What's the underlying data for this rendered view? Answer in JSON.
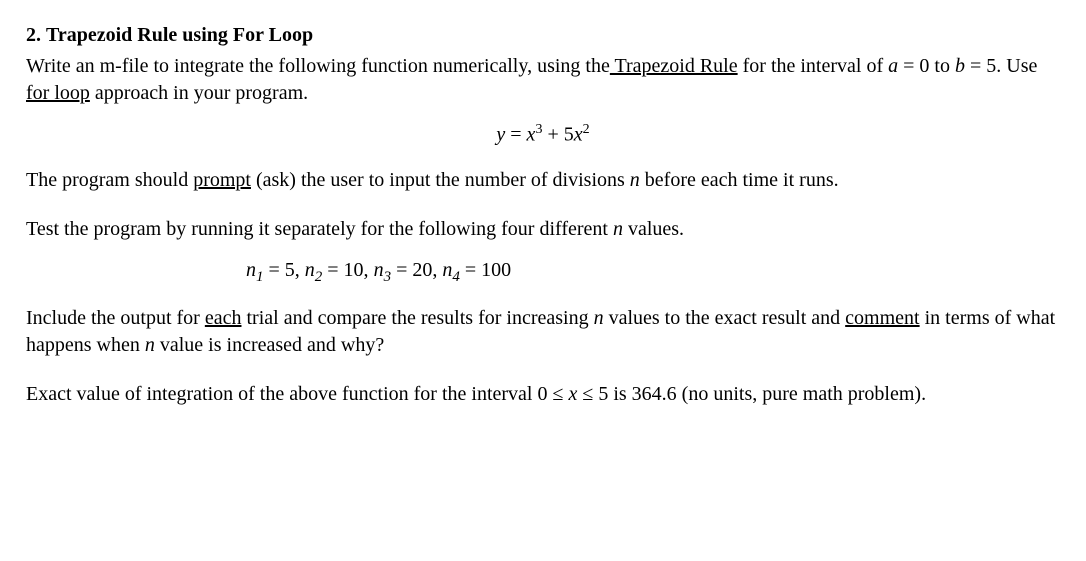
{
  "problem": {
    "number": "2.",
    "title": "Trapezoid Rule using For Loop",
    "intro_pre": "Write an m-file to integrate the following function numerically, using the",
    "intro_link1": " Trapezoid Rule",
    "intro_mid": " for the interval of ",
    "interval_a": "a",
    "interval_a_eq": " = 0",
    "interval_to": " to ",
    "interval_b": "b",
    "interval_b_eq": " = 5",
    "intro_use": ". Use ",
    "intro_link2": "for loop",
    "intro_end": " approach in your program.",
    "equation": {
      "lhs": "y",
      "eq": " = ",
      "rhs1": "x",
      "rhs1_exp": "3",
      "plus": " + 5",
      "rhs2": "x",
      "rhs2_exp": "2"
    },
    "prompt_pre": "The program should ",
    "prompt_link": "prompt",
    "prompt_post": " (ask) the user to input the number of divisions ",
    "prompt_n": "n",
    "prompt_end": " before each time it runs.",
    "test_pre": "Test the program by running it separately for the following four different ",
    "test_n": "n",
    "test_end": " values.",
    "nvals": {
      "n1_lbl": "n",
      "n1_sub": "1",
      "n1_val": " = 5, ",
      "n2_lbl": "n",
      "n2_sub": "2",
      "n2_val": " = 10, ",
      "n3_lbl": "n",
      "n3_sub": "3",
      "n3_val": " = 20, ",
      "n4_lbl": "n",
      "n4_sub": "4",
      "n4_val": " = 100"
    },
    "include_pre": "Include the output for ",
    "include_link1": "each",
    "include_mid1": " trial and compare the results for increasing ",
    "include_n1": "n",
    "include_mid2": " values to the exact result and ",
    "include_link2": "comment",
    "include_mid3": " in terms of what happens when ",
    "include_n2": "n",
    "include_end": " value is increased and why?",
    "exact_pre": "Exact value of integration of the above function for the interval 0 ≤ ",
    "exact_x": "x",
    "exact_mid": " ≤ 5 is ",
    "exact_val": "364.6",
    "exact_end": " (no units, pure math problem)."
  }
}
